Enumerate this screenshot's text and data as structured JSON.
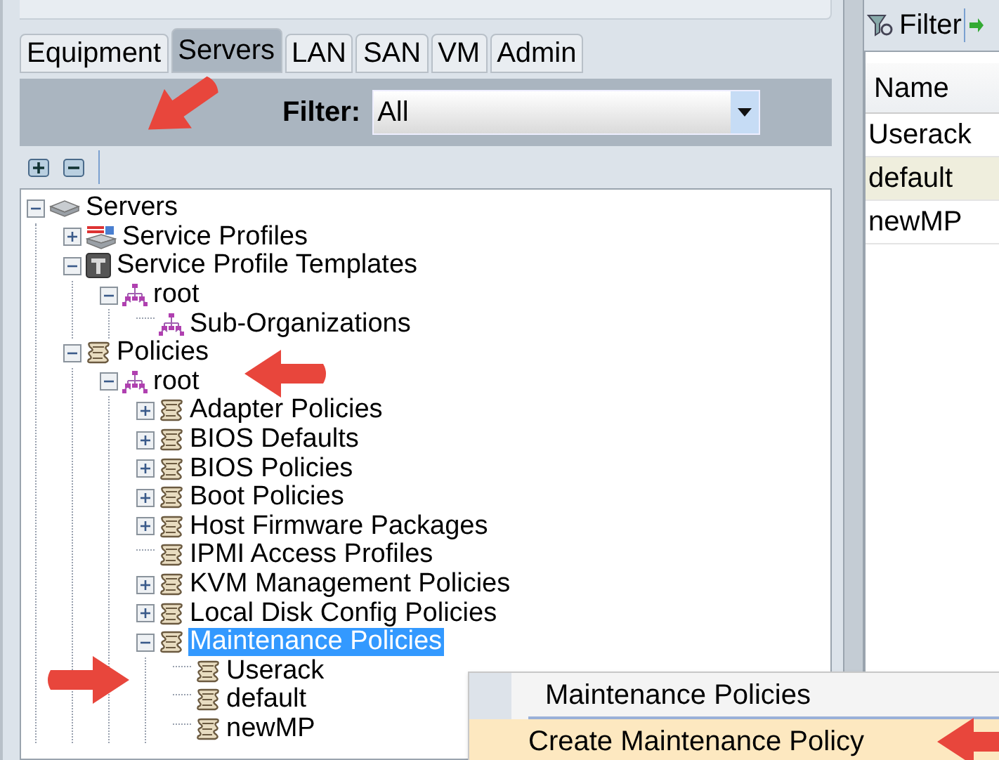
{
  "tabs": [
    {
      "label": "Equipment",
      "selected": false
    },
    {
      "label": "Servers",
      "selected": true
    },
    {
      "label": "LAN",
      "selected": false
    },
    {
      "label": "SAN",
      "selected": false
    },
    {
      "label": "VM",
      "selected": false
    },
    {
      "label": "Admin",
      "selected": false
    }
  ],
  "filter": {
    "label": "Filter:",
    "value": "All"
  },
  "tree": [
    {
      "label": "Servers",
      "kind": "server",
      "expanded": true,
      "selected": false,
      "children": [
        {
          "label": "Service Profiles",
          "kind": "profile",
          "expanded": false,
          "selected": false
        },
        {
          "label": "Service Profile Templates",
          "kind": "template",
          "expanded": true,
          "selected": false,
          "children": [
            {
              "label": "root",
              "kind": "org",
              "expanded": true,
              "selected": false,
              "children": [
                {
                  "label": "Sub-Organizations",
                  "kind": "org",
                  "selected": false
                }
              ]
            }
          ]
        },
        {
          "label": "Policies",
          "kind": "policy",
          "expanded": true,
          "selected": false,
          "children": [
            {
              "label": "root",
              "kind": "org",
              "expanded": true,
              "selected": false,
              "children": [
                {
                  "label": "Adapter Policies",
                  "kind": "policy",
                  "expanded": false,
                  "selected": false
                },
                {
                  "label": "BIOS Defaults",
                  "kind": "policy",
                  "expanded": false,
                  "selected": false
                },
                {
                  "label": "BIOS Policies",
                  "kind": "policy",
                  "expanded": false,
                  "selected": false
                },
                {
                  "label": "Boot Policies",
                  "kind": "policy",
                  "expanded": false,
                  "selected": false
                },
                {
                  "label": "Host Firmware Packages",
                  "kind": "policy",
                  "expanded": false,
                  "selected": false
                },
                {
                  "label": "IPMI Access Profiles",
                  "kind": "policy",
                  "selected": false
                },
                {
                  "label": "KVM Management Policies",
                  "kind": "policy",
                  "expanded": false,
                  "selected": false
                },
                {
                  "label": "Local Disk Config Policies",
                  "kind": "policy",
                  "expanded": false,
                  "selected": false
                },
                {
                  "label": "Maintenance Policies",
                  "kind": "policy",
                  "expanded": true,
                  "selected": true,
                  "children": [
                    {
                      "label": "Userack",
                      "kind": "policy",
                      "selected": false
                    },
                    {
                      "label": "default",
                      "kind": "policy",
                      "selected": false
                    },
                    {
                      "label": "newMP",
                      "kind": "policy",
                      "selected": false
                    }
                  ]
                }
              ]
            }
          ]
        }
      ]
    }
  ],
  "right_panel": {
    "filter_label": "Filter",
    "table": {
      "columns": [
        "Name"
      ],
      "rows": [
        {
          "name": "Userack",
          "selected": false
        },
        {
          "name": "default",
          "selected": true
        },
        {
          "name": "newMP",
          "selected": false
        }
      ]
    }
  },
  "context_menu": {
    "title": "Maintenance Policies",
    "items": [
      {
        "label": "Create Maintenance Policy",
        "selected": true
      }
    ]
  }
}
